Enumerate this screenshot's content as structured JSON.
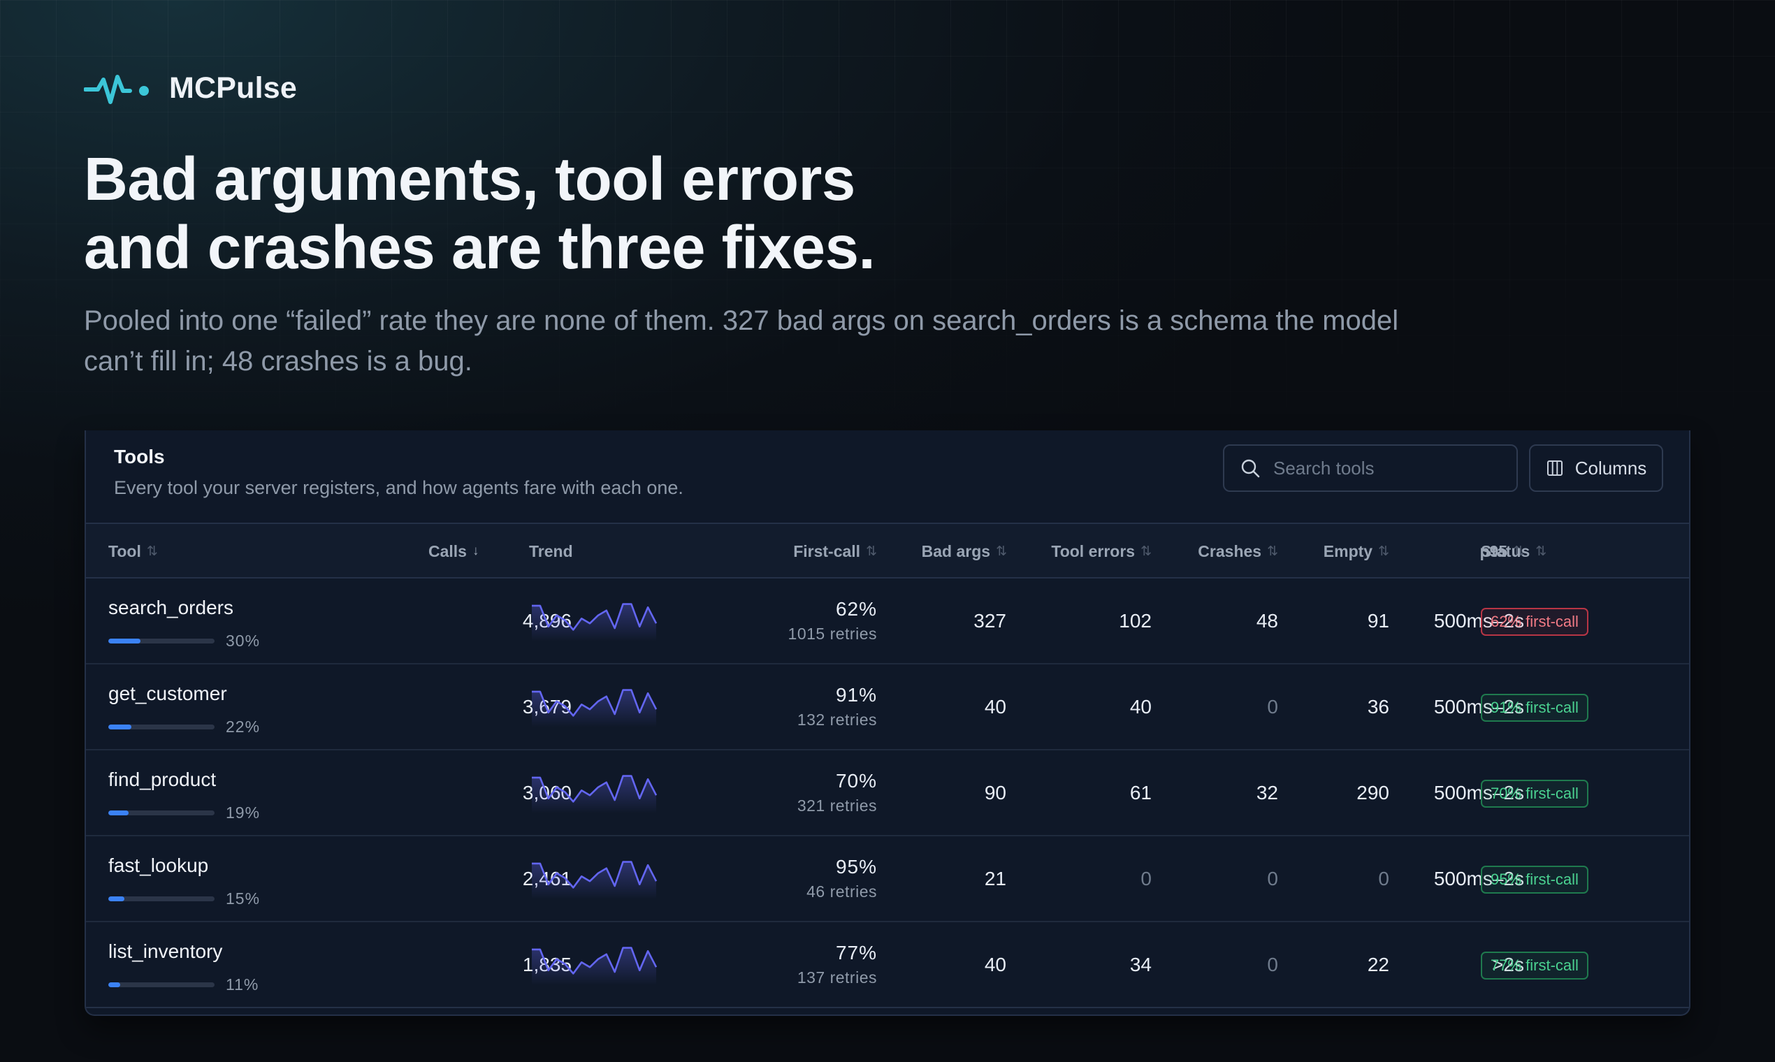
{
  "brand": {
    "name": "MCPulse",
    "logo_icon": "pulse-icon",
    "accent": "#3cc6d8"
  },
  "hero": {
    "headline_line1": "Bad arguments, tool errors",
    "headline_line2": "and crashes are three fixes.",
    "subtitle": "Pooled into one “failed” rate they are none of them. 327 bad args on search_orders is a schema the model can’t fill in; 48 crashes is a bug."
  },
  "tools_panel": {
    "title": "Tools",
    "description": "Every tool your server registers, and how agents fare with each one.",
    "search_placeholder": "Search tools",
    "columns_label": "Columns",
    "columns": [
      {
        "key": "tool",
        "label": "Tool",
        "sort": "none"
      },
      {
        "key": "calls",
        "label": "Calls",
        "sort": "desc"
      },
      {
        "key": "trend",
        "label": "Trend",
        "sort": ""
      },
      {
        "key": "first_call",
        "label": "First-call",
        "sort": "none"
      },
      {
        "key": "bad_args",
        "label": "Bad args",
        "sort": "none"
      },
      {
        "key": "tool_errors",
        "label": "Tool errors",
        "sort": "none"
      },
      {
        "key": "crashes",
        "label": "Crashes",
        "sort": "none"
      },
      {
        "key": "empty",
        "label": "Empty",
        "sort": "none"
      },
      {
        "key": "p95",
        "label": "p95",
        "sort": "none"
      },
      {
        "key": "status",
        "label": "Status",
        "sort": "none"
      }
    ],
    "rows": [
      {
        "tool": "search_orders",
        "share": 0.3,
        "share_label": "30%",
        "calls": "4,896",
        "first_call": "62%",
        "retries": "1015 retries",
        "bad_args": "327",
        "tool_errors": "102",
        "crashes": "48",
        "empty": "91",
        "p95": "500ms–2s",
        "status": "62% first-call",
        "status_kind": "bad"
      },
      {
        "tool": "get_customer",
        "share": 0.22,
        "share_label": "22%",
        "calls": "3,679",
        "first_call": "91%",
        "retries": "132 retries",
        "bad_args": "40",
        "tool_errors": "40",
        "crashes": "0",
        "empty": "36",
        "p95": "500ms–2s",
        "status": "91% first-call",
        "status_kind": "good"
      },
      {
        "tool": "find_product",
        "share": 0.19,
        "share_label": "19%",
        "calls": "3,060",
        "first_call": "70%",
        "retries": "321 retries",
        "bad_args": "90",
        "tool_errors": "61",
        "crashes": "32",
        "empty": "290",
        "p95": "500ms–2s",
        "status": "70% first-call",
        "status_kind": "good"
      },
      {
        "tool": "fast_lookup",
        "share": 0.15,
        "share_label": "15%",
        "calls": "2,461",
        "first_call": "95%",
        "retries": "46 retries",
        "bad_args": "21",
        "tool_errors": "0",
        "crashes": "0",
        "empty": "0",
        "p95": "500ms–2s",
        "status": "95% first-call",
        "status_kind": "good"
      },
      {
        "tool": "list_inventory",
        "share": 0.11,
        "share_label": "11%",
        "calls": "1,835",
        "first_call": "77%",
        "retries": "137 retries",
        "bad_args": "40",
        "tool_errors": "34",
        "crashes": "0",
        "empty": "22",
        "p95": ">2s",
        "status": "77% first-call",
        "status_kind": "good"
      }
    ],
    "trend_series": [
      0.85,
      0.85,
      0.2,
      0.55,
      0.4,
      0.1,
      0.45,
      0.3,
      0.55,
      0.7,
      0.15,
      0.9,
      0.9,
      0.2,
      0.8,
      0.3
    ],
    "colors": {
      "trend_line": "#6366f1",
      "share_fill": "#3b82f6",
      "status_bad": "#f17a85",
      "status_good": "#4ad190"
    }
  }
}
